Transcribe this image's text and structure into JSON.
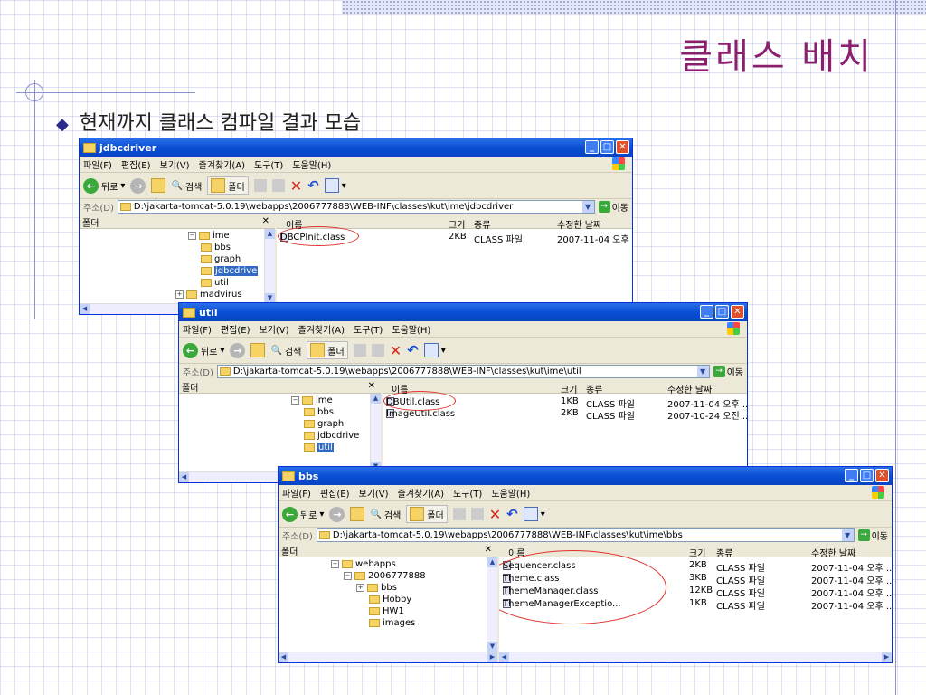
{
  "slide": {
    "title": "클래스 배치",
    "bullet": "현재까지 클래스 컴파일 결과 모습"
  },
  "menu": [
    "파일(F)",
    "편집(E)",
    "보기(V)",
    "즐겨찾기(A)",
    "도구(T)",
    "도움말(H)"
  ],
  "toolbar": {
    "back": "뒤로",
    "search": "검색",
    "folders": "폴더"
  },
  "address_label": "주소(D)",
  "go_label": "이동",
  "folder_pane_label": "폴더",
  "columns": {
    "name": "이름",
    "size": "크기",
    "type": "종류",
    "modified": "수정한 날짜"
  },
  "windows": [
    {
      "title": "jdbcdriver",
      "address": "D:\\jakarta-tomcat-5.0.19\\webapps\\2006777888\\WEB-INF\\classes\\kut\\ime\\jdbcdriver",
      "tree": [
        "ime",
        "bbs",
        "graph",
        "jdbcdrive",
        "util",
        "madvirus"
      ],
      "files": [
        {
          "name": "DBCPInit.class",
          "size": "2KB",
          "type": "CLASS 파일",
          "modified": "2007-11-04 오후 ..."
        }
      ]
    },
    {
      "title": "util",
      "address": "D:\\jakarta-tomcat-5.0.19\\webapps\\2006777888\\WEB-INF\\classes\\kut\\ime\\util",
      "tree": [
        "ime",
        "bbs",
        "graph",
        "jdbcdrive",
        "util"
      ],
      "files": [
        {
          "name": "DBUtil.class",
          "size": "1KB",
          "type": "CLASS 파일",
          "modified": "2007-11-04 오후 ..."
        },
        {
          "name": "ImageUtil.class",
          "size": "2KB",
          "type": "CLASS 파일",
          "modified": "2007-10-24 오전 ..."
        }
      ]
    },
    {
      "title": "bbs",
      "address": "D:\\jakarta-tomcat-5.0.19\\webapps\\2006777888\\WEB-INF\\classes\\kut\\ime\\bbs",
      "tree": [
        "webapps",
        "2006777888",
        "bbs",
        "Hobby",
        "HW1",
        "images"
      ],
      "files": [
        {
          "name": "Sequencer.class",
          "size": "2KB",
          "type": "CLASS 파일",
          "modified": "2007-11-04 오후 ..."
        },
        {
          "name": "Theme.class",
          "size": "3KB",
          "type": "CLASS 파일",
          "modified": "2007-11-04 오후 ..."
        },
        {
          "name": "ThemeManager.class",
          "size": "12KB",
          "type": "CLASS 파일",
          "modified": "2007-11-04 오후 ..."
        },
        {
          "name": "ThemeManagerExceptio...",
          "size": "1KB",
          "type": "CLASS 파일",
          "modified": "2007-11-04 오후 ..."
        }
      ]
    }
  ]
}
